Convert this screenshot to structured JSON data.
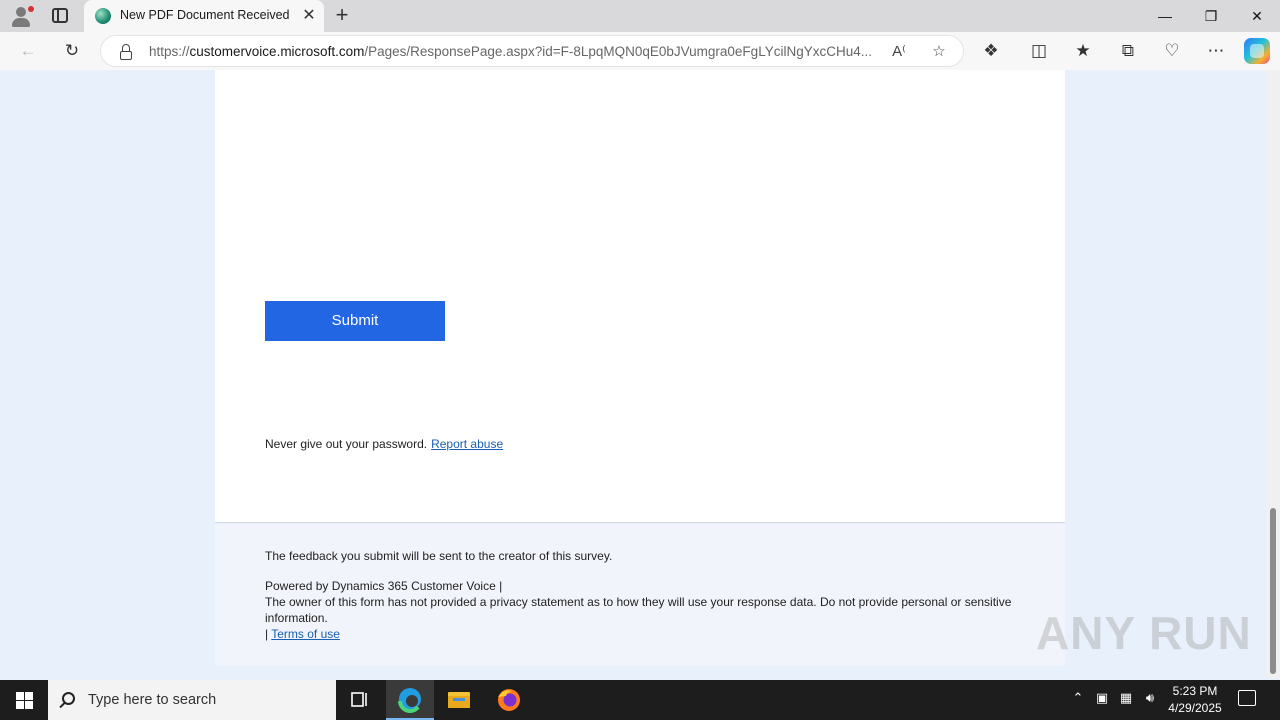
{
  "browser": {
    "tab_title": "New PDF Document Received",
    "tab_close": "✕",
    "new_tab": "+",
    "url_prefix": "https://",
    "url_host": "customervoice.microsoft.com",
    "url_path": "/Pages/ResponsePage.aspx?id=F-8LpqMQN0qE0bJVumgra0eFgLYcilNgYxcCHu4..."
  },
  "page": {
    "submit_label": "Submit",
    "password_warning": "Never give out your password.",
    "report_abuse": "Report abuse",
    "footer_feedback": "The feedback you submit will be sent to the creator of this survey.",
    "footer_powered": "Powered by Dynamics 365 Customer Voice |",
    "footer_privacy": "The owner of this form has not provided a privacy statement as to how they will use your response data. Do not provide personal or sensitive information.",
    "footer_pipe": "|",
    "terms_of_use": "Terms of use"
  },
  "watermark": "ANY RUN",
  "taskbar": {
    "search_placeholder": "Type here to search",
    "time": "5:23 PM",
    "date": "4/29/2025"
  }
}
